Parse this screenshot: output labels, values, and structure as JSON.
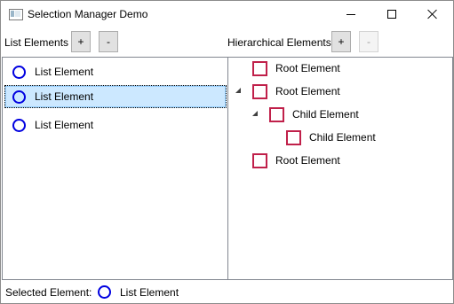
{
  "window": {
    "title": "Selection Manager Demo"
  },
  "toolbar": {
    "list_label": "List Elements",
    "list_add": "+",
    "list_remove": "-",
    "tree_label": "Hierarchical Elements",
    "tree_add": "+",
    "tree_remove": "-"
  },
  "list": {
    "items": [
      {
        "label": "List Element",
        "icon": "circle-icon",
        "selected": false
      },
      {
        "label": "List Element",
        "icon": "circle-icon",
        "selected": true
      },
      {
        "label": "List Element",
        "icon": "circle-icon",
        "selected": false
      }
    ]
  },
  "tree": {
    "nodes": [
      {
        "label": "Root Element",
        "icon": "square-icon",
        "expanded": null
      },
      {
        "label": "Root Element",
        "icon": "square-icon",
        "expanded": true
      },
      {
        "label": "Child Element",
        "icon": "square-icon",
        "expanded": true
      },
      {
        "label": "Child Element",
        "icon": "square-icon",
        "expanded": null
      },
      {
        "label": "Root Element",
        "icon": "square-icon",
        "expanded": null
      }
    ]
  },
  "status": {
    "label": "Selected Element:",
    "value": "List Element",
    "icon": "circle-icon"
  },
  "colors": {
    "circle": "#0000e0",
    "square": "#c0204a",
    "selection_bg": "#cce8ff"
  }
}
